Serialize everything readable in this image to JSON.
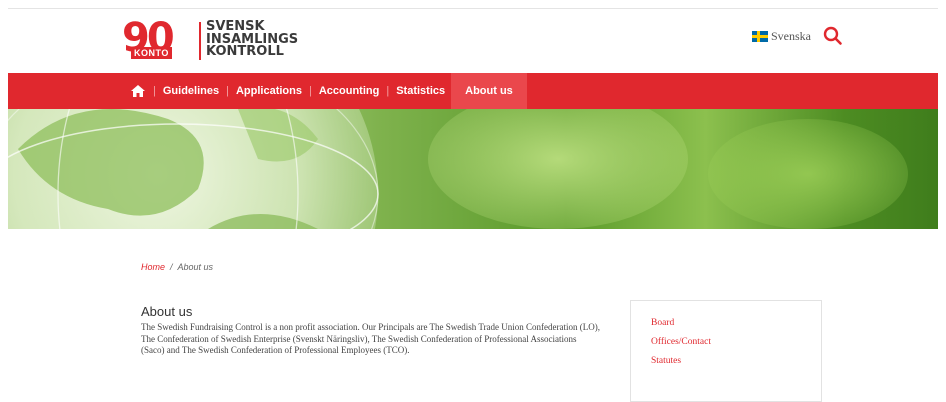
{
  "header": {
    "logo": {
      "number": "90",
      "konto": "KONTO",
      "line1": "SVENSK",
      "line2": "INSAMLINGS",
      "line3": "KONTROLL"
    },
    "language_label": "Svenska"
  },
  "nav": {
    "items": [
      {
        "label": "Guidelines"
      },
      {
        "label": "Applications"
      },
      {
        "label": "Accounting"
      },
      {
        "label": "Statistics"
      },
      {
        "label": "About us"
      }
    ],
    "active": "About us"
  },
  "breadcrumb": {
    "home": "Home",
    "separator": "/",
    "current": "About us"
  },
  "main": {
    "title": "About us",
    "body": "The Swedish Fundraising Control is a non profit association. Our Principals are The Swedish Trade Union Confederation (LO), The Confederation of Swedish Enterprise (Svenskt Näringsliv), The Swedish Confederation of Professional Associations (Saco) and The Swedish Confederation of Professional Employees (TCO)."
  },
  "sidebar": {
    "links": [
      {
        "label": "Board"
      },
      {
        "label": "Offices/Contact"
      },
      {
        "label": "Statutes"
      }
    ]
  },
  "colors": {
    "brand_red": "#e0282e",
    "nav_active": "#ea474c",
    "text": "#444444"
  },
  "icons": {
    "home": "home-icon",
    "search": "search-icon",
    "flag": "swedish-flag-icon"
  }
}
